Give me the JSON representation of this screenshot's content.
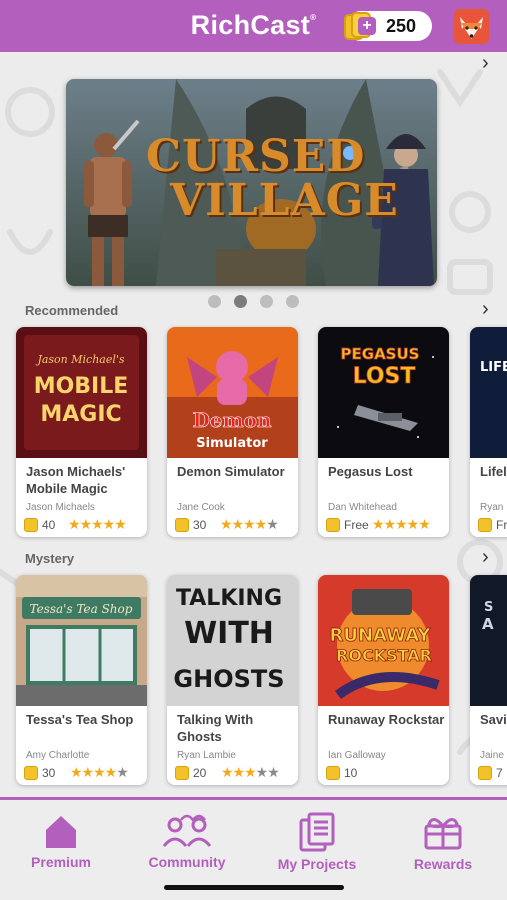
{
  "header": {
    "app_title": "RichCast",
    "trademark": "®",
    "coin_balance": "250",
    "add_coins_symbol": "+"
  },
  "hero": {
    "title_line1": "CURSED",
    "title_line2": "VILLAGE",
    "carousel_total": 4,
    "carousel_active": 2
  },
  "sections": {
    "recommended": {
      "label": "Recommended",
      "cards": [
        {
          "title": "Jason Michaels' Mobile Magic",
          "author": "Jason Michaels",
          "price": "40",
          "rating": 5,
          "cover_text1": "Jason Michael's",
          "cover_text2": "MOBILE",
          "cover_text3": "MAGIC"
        },
        {
          "title": "Demon Simulator",
          "author": "Jane Cook",
          "price": "30",
          "rating": 4,
          "cover_text1": "Demon",
          "cover_text2": "Simulator"
        },
        {
          "title": "Pegasus Lost",
          "author": "Dan Whitehead",
          "price": "Free",
          "rating": 5,
          "cover_text1": "PEGASUS",
          "cover_text2": "LOST"
        },
        {
          "title": "Lifel",
          "author": "Ryan",
          "price": "Fr",
          "cover_text1": "LIFE"
        }
      ]
    },
    "mystery": {
      "label": "Mystery",
      "cards": [
        {
          "title": "Tessa's Tea Shop",
          "author": "Amy Charlotte",
          "price": "30",
          "rating": 4,
          "cover_text1": "Tessa's Tea Shop"
        },
        {
          "title": "Talking With Ghosts",
          "author": "Ryan Lambie",
          "price": "20",
          "rating": 3,
          "cover_text1": "TALKING",
          "cover_text2": "WITH",
          "cover_text3": "GHOSTS"
        },
        {
          "title": "Runaway Rockstar",
          "author": "Ian Galloway",
          "price": "10",
          "rating": 0,
          "cover_text1": "RUNAWAY",
          "cover_text2": "ROCKSTAR"
        },
        {
          "title": "Savi Arks",
          "author": "Jaine",
          "price": "7",
          "cover_text1": "S",
          "cover_text2": "A"
        }
      ]
    }
  },
  "nav": {
    "premium": "Premium",
    "community": "Community",
    "my_projects": "My Projects",
    "rewards": "Rewards"
  },
  "colors": {
    "brand": "#b35fbe",
    "star": "#f2a91c",
    "coin": "#f3c22a"
  },
  "icons": [
    "coin-icon",
    "plus-icon",
    "fox-avatar-icon",
    "chevron-right-icon",
    "star-icon",
    "home-icon",
    "community-icon",
    "projects-icon",
    "gift-icon"
  ]
}
